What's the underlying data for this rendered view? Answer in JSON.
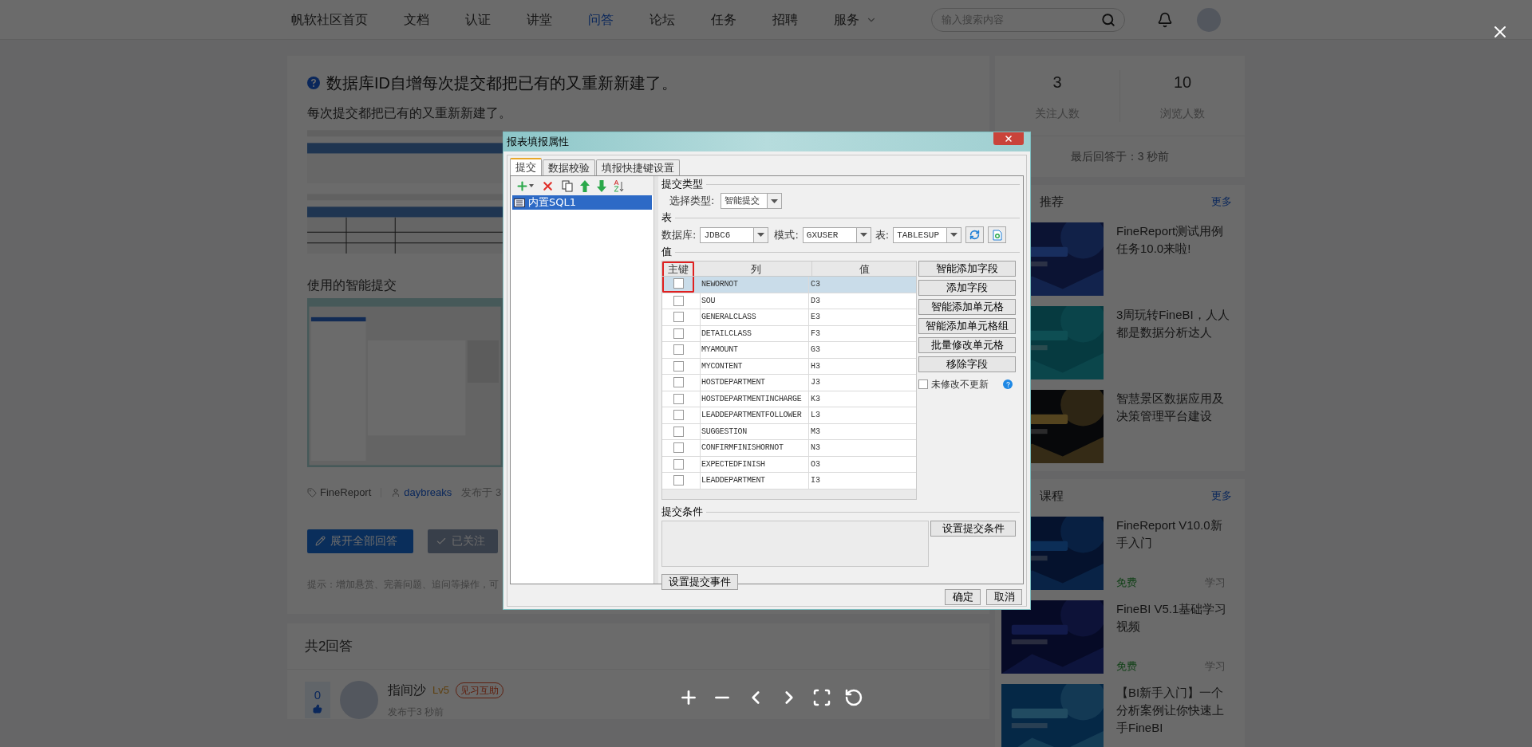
{
  "nav": {
    "items": [
      {
        "label": "帆软社区首页",
        "selected": false
      },
      {
        "label": "文档",
        "selected": false
      },
      {
        "label": "认证",
        "selected": false
      },
      {
        "label": "讲堂",
        "selected": false
      },
      {
        "label": "问答",
        "selected": true
      },
      {
        "label": "论坛",
        "selected": false
      },
      {
        "label": "任务",
        "selected": false
      },
      {
        "label": "招聘",
        "selected": false
      },
      {
        "label": "服务",
        "selected": false,
        "dropdown": true
      }
    ],
    "search": {
      "placeholder": "输入搜索内容"
    }
  },
  "question": {
    "title": "数据库ID自增每次提交都把已有的又重新新建了。",
    "body": "每次提交都把已有的又重新新建了。",
    "caption": "使用的智能提交",
    "category": "FineReport",
    "author": "daybreaks",
    "posted": "发布于 3",
    "buttons": [
      {
        "label": "展开全部回答",
        "kind": "primary"
      },
      {
        "label": "已关注",
        "kind": "muted"
      }
    ],
    "hint": "提示：增加悬赏、完善问题、追问等操作，可"
  },
  "answers": {
    "count": "共2回答",
    "first": {
      "votes": "0",
      "name": "指间沙",
      "level": "Lv5",
      "badge": "见习互助",
      "posted": "发布于3 秒前"
    }
  },
  "sidebar": {
    "stats": [
      {
        "value": "3",
        "label": "关注人数"
      },
      {
        "value": "10",
        "label": "浏览人数"
      }
    ],
    "last_answer": "最后回答于：3 秒前",
    "recommend": {
      "heading": "推荐",
      "more": "更多",
      "items": [
        {
          "title": "FineReport测试用例任务10.0来啦!"
        },
        {
          "title": "3周玩转FineBI，人人都是数据分析达人"
        },
        {
          "title": "智慧景区数据应用及决策管理平台建设"
        }
      ]
    },
    "courses": {
      "heading": "课程",
      "more": "更多",
      "items": [
        {
          "title": "FineReport V10.0新手入门",
          "price": "免费",
          "category": "学习"
        },
        {
          "title": "FineBI V5.1基础学习视频",
          "price": "免费",
          "category": "学习"
        },
        {
          "title": "【BI新手入门】一个分析案例让你快速上手FineBI"
        }
      ]
    }
  },
  "dialog": {
    "title": "报表填报属性",
    "tabs": [
      {
        "label": "提交",
        "selected": true
      },
      {
        "label": "数据校验",
        "selected": false
      },
      {
        "label": "填报快捷键设置",
        "selected": false
      }
    ],
    "tree": [
      {
        "label": "内置SQL1",
        "selected": true
      }
    ],
    "submit_type": {
      "legend": "提交类型",
      "label": "选择类型:",
      "value": "智能提交"
    },
    "table": {
      "legend": "表",
      "db_label": "数据库:",
      "db": "JDBC6",
      "schema_label": "模式:",
      "schema": "GXUSER",
      "table_label": "表:",
      "table": "TABLESUP"
    },
    "values": {
      "legend": "值",
      "columns": [
        "主键",
        "列",
        "值"
      ],
      "rows": [
        {
          "column": "NEWORNOT",
          "value": "C3",
          "checked": false,
          "selected": true
        },
        {
          "column": "SOU",
          "value": "D3",
          "checked": false,
          "selected": false
        },
        {
          "column": "GENERALCLASS",
          "value": "E3",
          "checked": false,
          "selected": false
        },
        {
          "column": "DETAILCLASS",
          "value": "F3",
          "checked": false,
          "selected": false
        },
        {
          "column": "MYAMOUNT",
          "value": "G3",
          "checked": false,
          "selected": false
        },
        {
          "column": "MYCONTENT",
          "value": "H3",
          "checked": false,
          "selected": false
        },
        {
          "column": "HOSTDEPARTMENT",
          "value": "J3",
          "checked": false,
          "selected": false
        },
        {
          "column": "HOSTDEPARTMENTINCHARGE",
          "value": "K3",
          "checked": false,
          "selected": false
        },
        {
          "column": "LEADDEPARTMENTFOLLOWER",
          "value": "L3",
          "checked": false,
          "selected": false
        },
        {
          "column": "SUGGESTION",
          "value": "M3",
          "checked": false,
          "selected": false
        },
        {
          "column": "CONFIRMFINISHORNOT",
          "value": "N3",
          "checked": false,
          "selected": false
        },
        {
          "column": "EXPECTEDFINISH",
          "value": "O3",
          "checked": false,
          "selected": false
        },
        {
          "column": "LEADDEPARTMENT",
          "value": "I3",
          "checked": false,
          "selected": false
        }
      ],
      "key_highlight": true,
      "buttons": [
        "智能添加字段",
        "添加字段",
        "智能添加单元格",
        "智能添加单元格组",
        "批量修改单元格",
        "移除字段"
      ],
      "no_update": {
        "label": "未修改不更新",
        "checked": false
      }
    },
    "condition": {
      "legend": "提交条件",
      "button": "设置提交条件"
    },
    "event_button": "设置提交事件",
    "footer": [
      "确定",
      "取消"
    ]
  }
}
